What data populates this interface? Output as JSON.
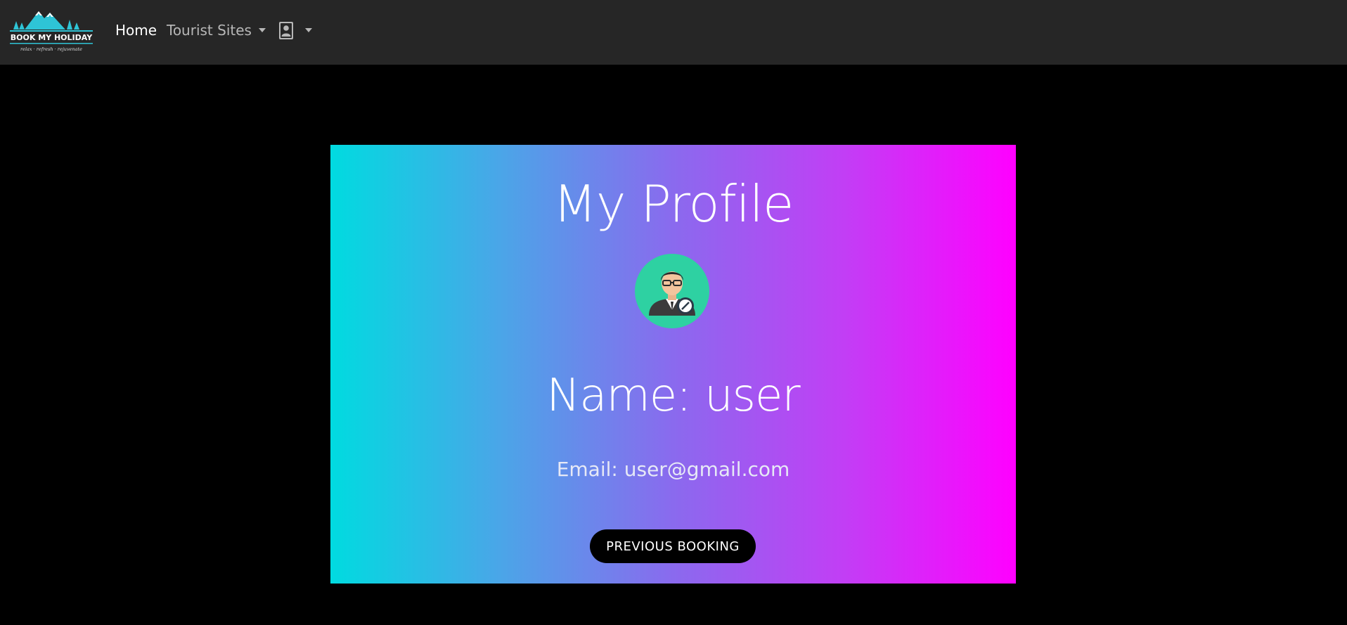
{
  "navbar": {
    "brand": {
      "name": "BOOK MY HOLIDAY",
      "tagline": "relax · refresh · rejuvenate",
      "icon": "mountain-logo"
    },
    "home_label": "Home",
    "tourist_sites_label": "Tourist Sites",
    "user_menu_icon": "user-contact-icon"
  },
  "profile": {
    "title": "My Profile",
    "avatar_icon": "user-edit-avatar-icon",
    "name_text": "Name: user",
    "email_text": "Email: user@gmail.com",
    "previous_booking_label": "PREVIOUS BOOKING"
  },
  "colors": {
    "navbar_bg": "#262626",
    "page_bg": "#000000",
    "gradient_start": "#00dbe0",
    "gradient_end": "#ff00ff",
    "avatar_bg": "#2ed1a2"
  }
}
